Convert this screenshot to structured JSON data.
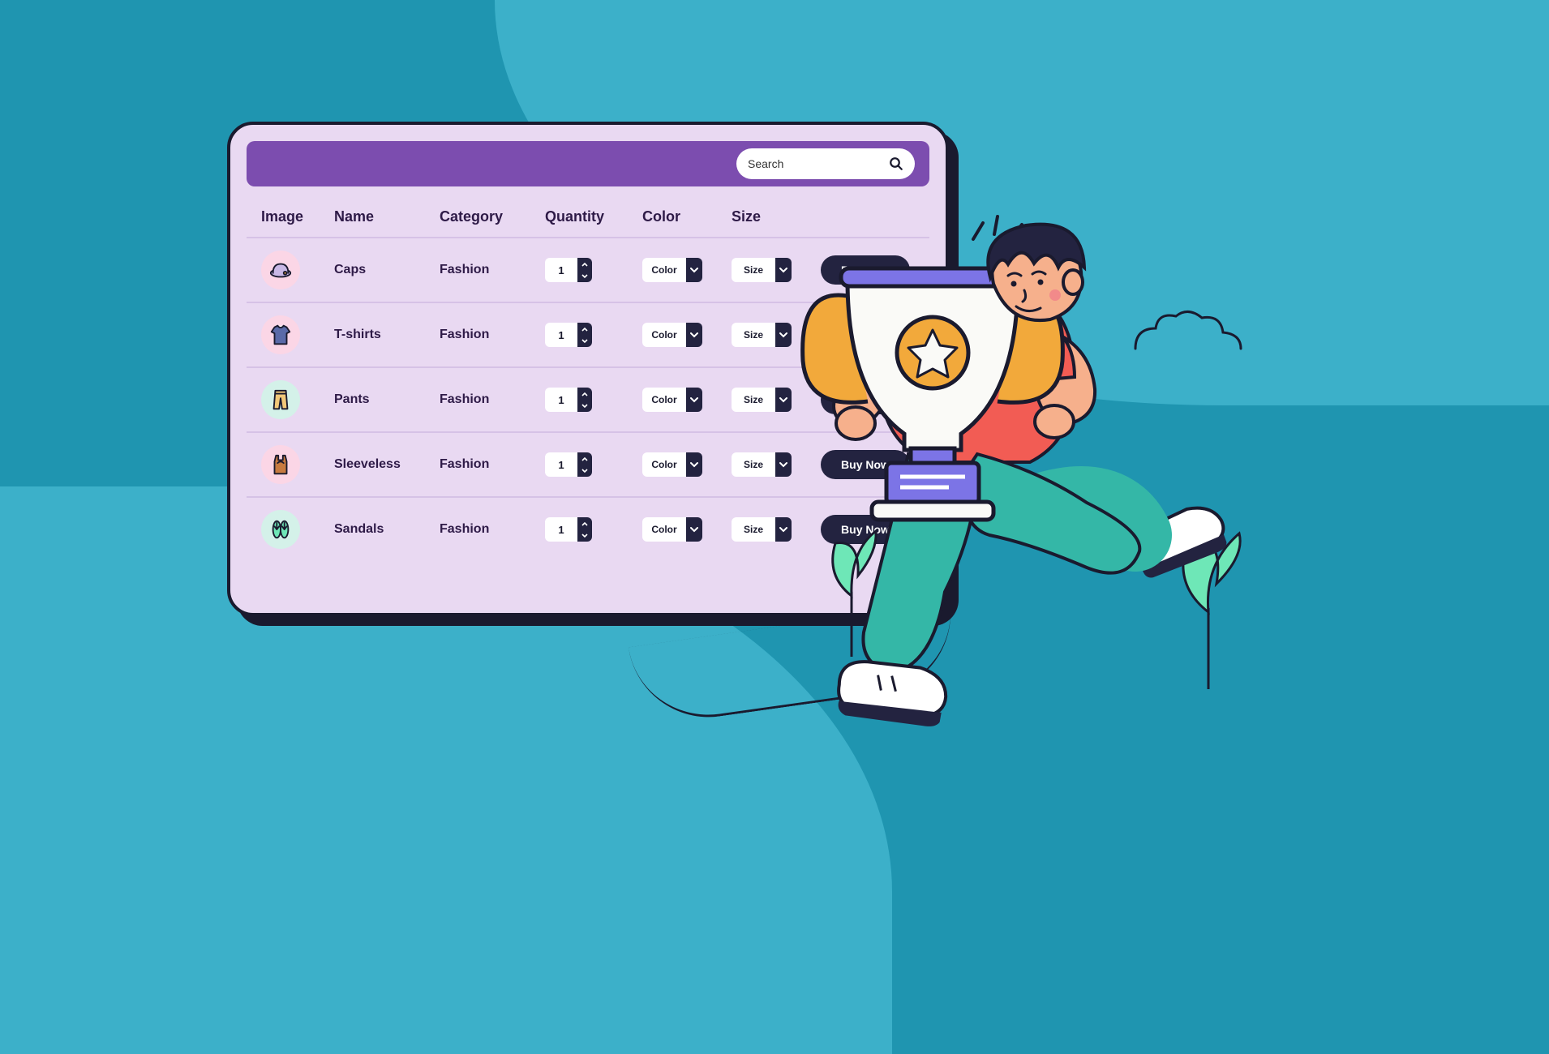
{
  "search": {
    "placeholder": "Search"
  },
  "columns": [
    "Image",
    "Name",
    "Category",
    "Quantity",
    "Color",
    "Size"
  ],
  "labels": {
    "color": "Color",
    "size": "Size",
    "buy": "Buy Now"
  },
  "rows": [
    {
      "name": "Caps",
      "category": "Fashion",
      "qty": "1",
      "icon": "cap",
      "bg": "bg-pink"
    },
    {
      "name": "T-shirts",
      "category": "Fashion",
      "qty": "1",
      "icon": "tshirt",
      "bg": "bg-pink"
    },
    {
      "name": "Pants",
      "category": "Fashion",
      "qty": "1",
      "icon": "pants",
      "bg": "bg-mint"
    },
    {
      "name": "Sleeveless",
      "category": "Fashion",
      "qty": "1",
      "icon": "sleeveless",
      "bg": "bg-pink"
    },
    {
      "name": "Sandals",
      "category": "Fashion",
      "qty": "1",
      "icon": "sandals",
      "bg": "bg-mint"
    }
  ]
}
